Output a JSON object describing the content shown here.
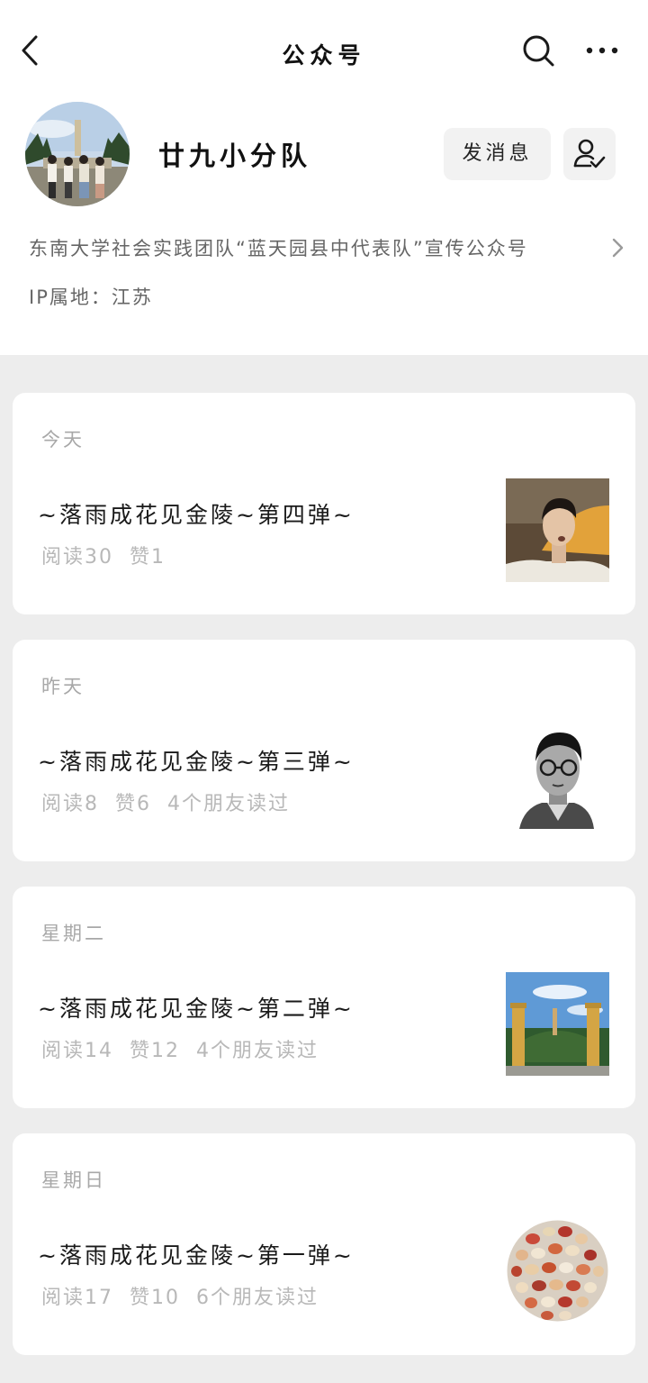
{
  "header": {
    "title": "公众号"
  },
  "account": {
    "name": "廿九小分队",
    "message_button": "发消息",
    "description": "东南大学社会实践团队“蓝天园县中代表队”宣传公众号",
    "ip_location": "IP属地：江苏"
  },
  "articles": [
    {
      "date": "今天",
      "title": "~落雨成花见金陵~第四弹~",
      "reads": "阅读30",
      "likes": "赞1",
      "friends": ""
    },
    {
      "date": "昨天",
      "title": "~落雨成花见金陵~第三弹~",
      "reads": "阅读8",
      "likes": "赞6",
      "friends": "4个朋友读过"
    },
    {
      "date": "星期二",
      "title": "~落雨成花见金陵~第二弹~",
      "reads": "阅读14",
      "likes": "赞12",
      "friends": "4个朋友读过"
    },
    {
      "date": "星期日",
      "title": "~落雨成花见金陵~第一弹~",
      "reads": "阅读17",
      "likes": "赞10",
      "friends": "6个朋友读过"
    }
  ],
  "icons": {
    "back": "chevron-left-icon",
    "search": "search-icon",
    "more": "more-icon",
    "follow": "followed-user-icon",
    "description_arrow": "chevron-right-icon"
  }
}
